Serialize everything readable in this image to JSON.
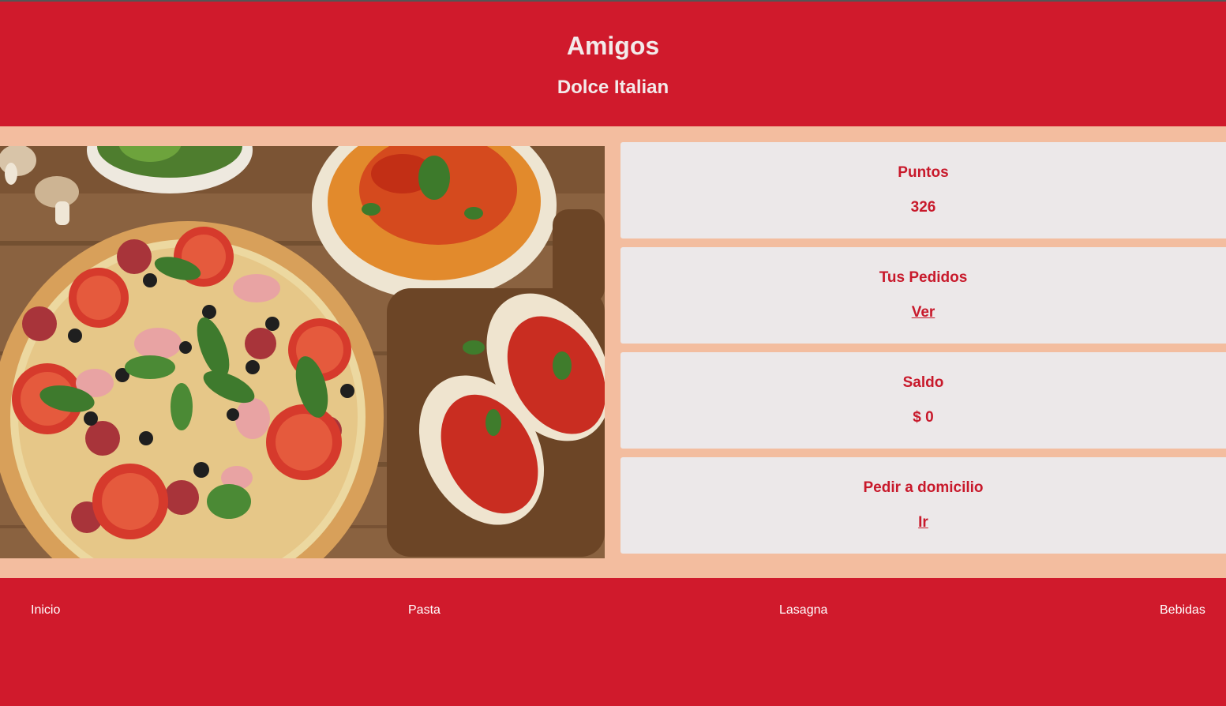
{
  "header": {
    "title": "Amigos",
    "subtitle": "Dolce Italian"
  },
  "hero": {
    "icon": "food-photo-pizza-pasta-bruschetta"
  },
  "cards": {
    "points": {
      "title": "Puntos",
      "value": "326"
    },
    "orders": {
      "title": "Tus Pedidos",
      "link": "Ver"
    },
    "balance": {
      "title": "Saldo",
      "value": "$ 0"
    },
    "delivery": {
      "title": "Pedir a domicilio",
      "link": "Ir"
    }
  },
  "nav": {
    "items": [
      "Inicio",
      "Pasta",
      "Lasagna",
      "Bebidas"
    ]
  },
  "colors": {
    "primary_red": "#d01a2c",
    "peach_background": "#f3bd9f",
    "card_background": "#ece8e9",
    "card_text": "#c8192b"
  }
}
